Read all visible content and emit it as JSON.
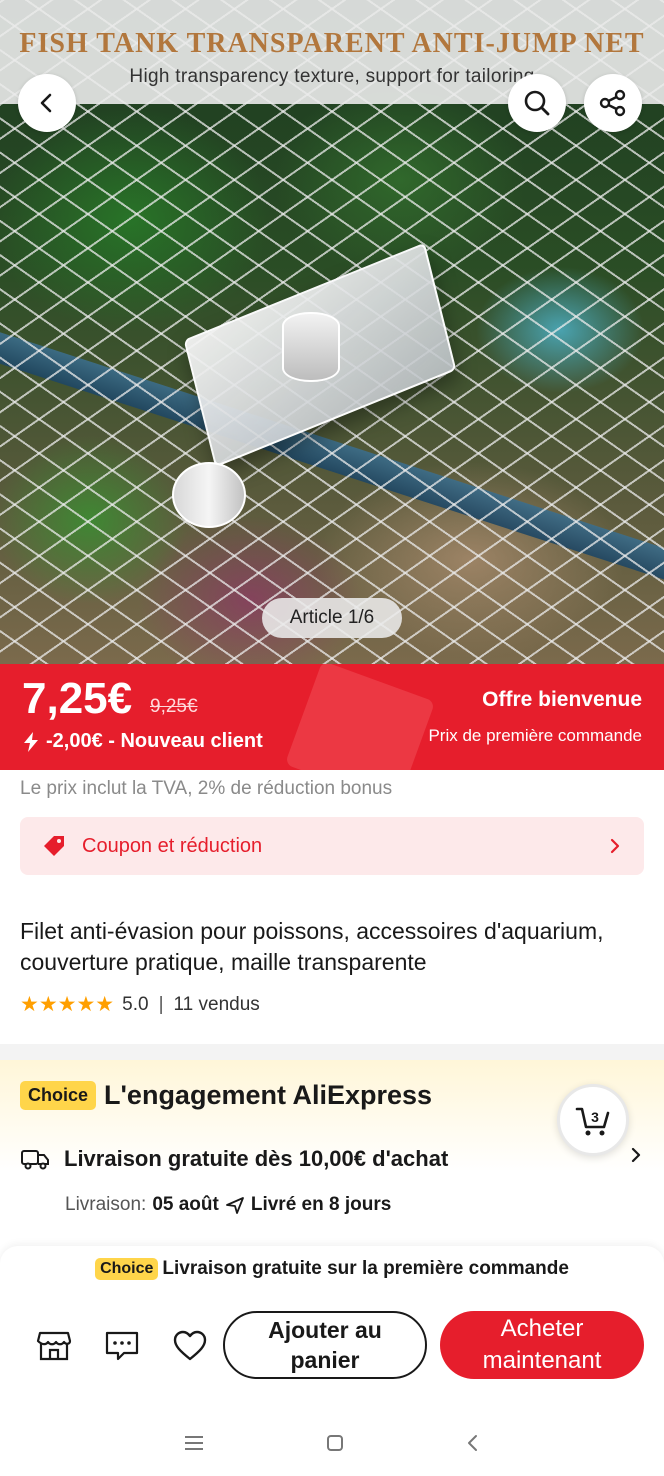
{
  "hero": {
    "banner_title": "FISH TANK TRANSPARENT ANTI-JUMP NET",
    "banner_subtitle": "High transparency texture, support for tailoring",
    "image_counter": "Article 1/6"
  },
  "header": {
    "back_icon": "arrow-left-icon",
    "search_icon": "search-icon",
    "share_icon": "share-icon"
  },
  "price": {
    "current": "7,25€",
    "original": "9,25€",
    "discount": "-2,00€ - Nouveau client",
    "offer_title": "Offre bienvenue",
    "offer_subtitle": "Prix de première commande",
    "accent_color": "#e61e2c"
  },
  "vat_note": "Le prix inclut la TVA, 2% de réduction bonus",
  "coupon": {
    "label": "Coupon et réduction"
  },
  "product": {
    "title": "Filet anti-évasion pour poissons, accessoires d'aquarium, couverture pratique, maille transparente",
    "rating": "5.0",
    "stars": 5,
    "sold": "11 vendus"
  },
  "choice": {
    "badge": "Choice",
    "heading": "L'engagement AliExpress",
    "cart_count": "3",
    "delivery_title": "Livraison gratuite dès 10,00€ d'achat",
    "delivery_label": "Livraison:",
    "delivery_date": "05 août",
    "delivery_time": "Livré en 8 jours"
  },
  "bottom": {
    "promo_badge": "Choice",
    "promo_text": "Livraison gratuite sur la première commande",
    "add_to_cart": "Ajouter au panier",
    "buy_now": "Acheter maintenant"
  }
}
